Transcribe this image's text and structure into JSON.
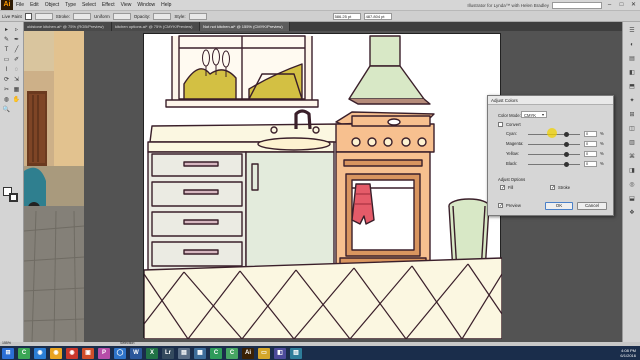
{
  "app": {
    "logo": "Ai",
    "menus": [
      "File",
      "Edit",
      "Object",
      "Type",
      "Select",
      "Effect",
      "View",
      "Window",
      "Help"
    ],
    "workspace": "Illustrator for Lynda™ with Helen Bradley"
  },
  "control_bar": {
    "selection_label": "Live Paint",
    "stroke_label": "Stroke:",
    "stroke_style": "Uniform",
    "opacity_label": "Opacity:",
    "style_label": "Style:",
    "x_value": "586.25 pt",
    "w_value": "487.804 pt"
  },
  "tabs": [
    {
      "label": "oldstone kitchen.ai* @ 75% (RGB/Preview)"
    },
    {
      "label": "kitchen options.ai* @ 75% (CMYK/Preview)"
    },
    {
      "label": "Not not kitchen.ai* @ 155% (CMYK/Preview)"
    }
  ],
  "tools": [
    "▸",
    "▹",
    "✎",
    "✒",
    "T",
    "╱",
    "▭",
    "✐",
    "⌇",
    "◌",
    "⟳",
    "⇲",
    "✂",
    "▦",
    "◍",
    "✋",
    "🔍"
  ],
  "dock_icons": [
    "☰",
    "◐",
    "▤",
    "◧",
    "⬒",
    "✦",
    "⊞",
    "◫",
    "▥",
    "⌘",
    "◨",
    "◎",
    "⬓",
    "❖"
  ],
  "dialog": {
    "title": "Adjust Colors",
    "color_mode_label": "Color Mode:",
    "color_mode_value": "CMYK",
    "convert_label": "Convert",
    "channels": [
      {
        "label": "Cyan:",
        "value": "0",
        "unit": "%",
        "knob": 0.25
      },
      {
        "label": "Magenta:",
        "value": "0",
        "unit": "%",
        "knob": 0.25
      },
      {
        "label": "Yellow:",
        "value": "0",
        "unit": "%",
        "knob": 0.25
      },
      {
        "label": "Black:",
        "value": "0",
        "unit": "%",
        "knob": 0.25
      }
    ],
    "adjust_options_label": "Adjust Options",
    "fill_label": "Fill",
    "stroke_label": "Stroke",
    "preview_label": "Preview",
    "ok_label": "OK",
    "cancel_label": "Cancel"
  },
  "status": {
    "zoom": "155%",
    "tool": "Selection",
    "time": "4:08 PM",
    "date": "6/1/2016"
  },
  "taskbar_icons": [
    {
      "label": "C",
      "color": "#3aa655"
    },
    {
      "label": "◉",
      "color": "#2b7fd6"
    },
    {
      "label": "◉",
      "color": "#e8a321"
    },
    {
      "label": "◉",
      "color": "#c9372c"
    },
    {
      "label": "▣",
      "color": "#cf4e2a"
    },
    {
      "label": "P",
      "color": "#b64da8"
    },
    {
      "label": "◯",
      "color": "#2e74c9"
    },
    {
      "label": "W",
      "color": "#2b579a"
    },
    {
      "label": "X",
      "color": "#217346"
    },
    {
      "label": "Lr",
      "color": "#344a5e"
    },
    {
      "label": "▤",
      "color": "#5a6e86"
    },
    {
      "label": "▦",
      "color": "#3d6d9a"
    },
    {
      "label": "C",
      "color": "#2f9b5a"
    },
    {
      "label": "C",
      "color": "#47a563"
    },
    {
      "label": "Ai",
      "color": "#3a2105"
    },
    {
      "label": "▭",
      "color": "#d4a62a"
    },
    {
      "label": "◧",
      "color": "#4b4b9a"
    },
    {
      "label": "▥",
      "color": "#2e7d9a"
    }
  ],
  "colors": {
    "orange": "#f7c08f",
    "olive": "#d3c043",
    "green": "#d8e8c6",
    "red": "#e55b69",
    "cream": "#fbf7e1",
    "outline": "#3a1f2a"
  }
}
